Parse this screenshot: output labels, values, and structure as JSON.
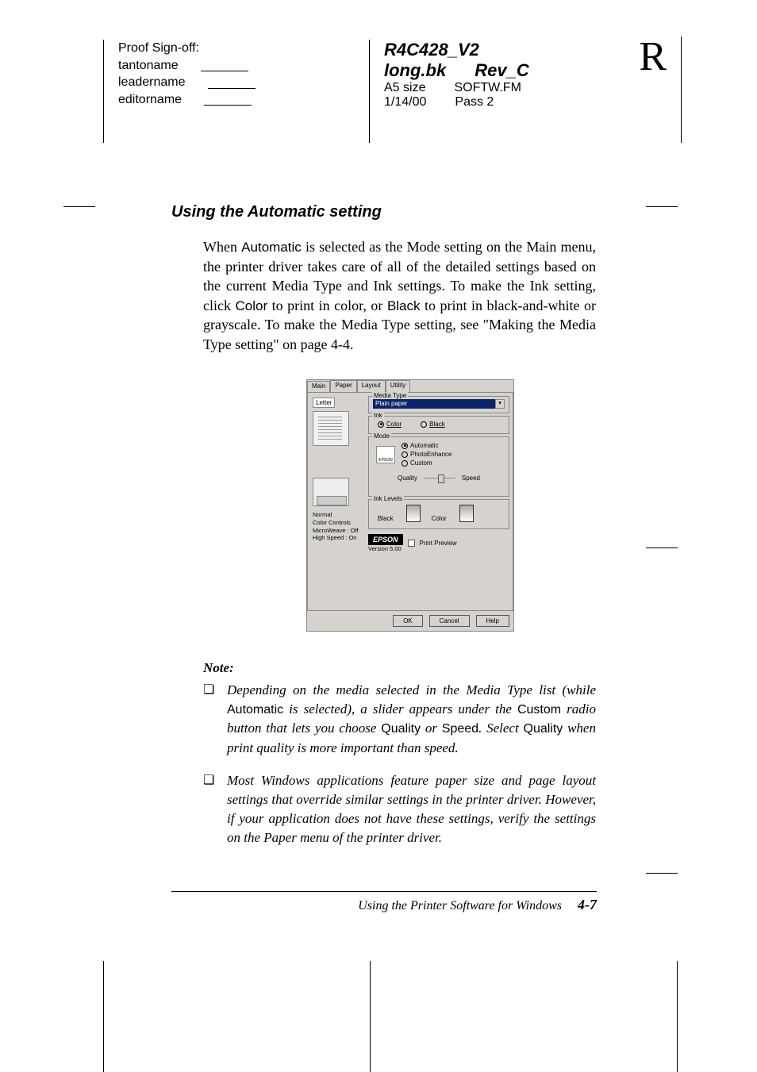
{
  "signoff": {
    "title": "Proof Sign-off:",
    "tanto": "tantoname",
    "leader": "leadername",
    "editor": "editorname"
  },
  "docinfo": {
    "code": "R4C428_V2",
    "file": "long.bk",
    "rev": "Rev_C",
    "size": "A5 size",
    "fm": "SOFTW.FM",
    "date": "1/14/00",
    "pass": "Pass 2"
  },
  "page_marker": "R",
  "heading": "Using the Automatic setting",
  "para": {
    "p1a": "When ",
    "p1b": "Automatic",
    "p1c": " is selected as the Mode setting on the Main menu, the printer driver takes care of all of the detailed settings based on the current Media Type and Ink settings. To make the Ink setting, click ",
    "p1d": "Color",
    "p1e": " to print in color, or ",
    "p1f": "Black",
    "p1g": " to print in black-and-white or grayscale. To make the Media Type setting, see \"Making the Media Type setting\" on page 4-4."
  },
  "dialog": {
    "tabs": {
      "main": "Main",
      "paper": "Paper",
      "layout": "Layout",
      "utility": "Utility"
    },
    "left": {
      "paper_size": "Letter",
      "status1": "Normal",
      "status2": "Color Controls",
      "status3": "MicroWeave : Off",
      "status4": "High Speed : On"
    },
    "media": {
      "legend": "Media Type",
      "value": "Plain paper"
    },
    "ink": {
      "legend": "Ink",
      "color": "Color",
      "black": "Black"
    },
    "mode": {
      "legend": "Mode",
      "icon_label": "EPSON",
      "automatic": "Automatic",
      "photoenhance": "PhotoEnhance",
      "custom": "Custom",
      "quality": "Quality",
      "speed": "Speed"
    },
    "inklevels": {
      "legend": "Ink Levels",
      "black": "Black",
      "color": "Color"
    },
    "brand": "EPSON",
    "version": "Version 5.00",
    "print_preview": "Print Preview",
    "buttons": {
      "ok": "OK",
      "cancel": "Cancel",
      "help": "Help"
    }
  },
  "note": {
    "heading": "Note:",
    "item1": {
      "a": "Depending on the media selected in the Media Type list (while ",
      "b": "Automatic",
      "c": " is selected), a slider appears under the ",
      "d": "Custom",
      "e": " radio button that lets you choose ",
      "f": "Quality",
      "g": " or ",
      "h": "Speed",
      "i": ". Select ",
      "j": "Quality",
      "k": " when print quality is more important than speed."
    },
    "item2": "Most Windows applications feature paper size and page layout settings that override similar settings in the printer driver. However, if your application does not have these settings, verify the settings on the Paper menu of the printer driver."
  },
  "footer": {
    "text": "Using the Printer Software for Windows",
    "page": "4-7"
  }
}
